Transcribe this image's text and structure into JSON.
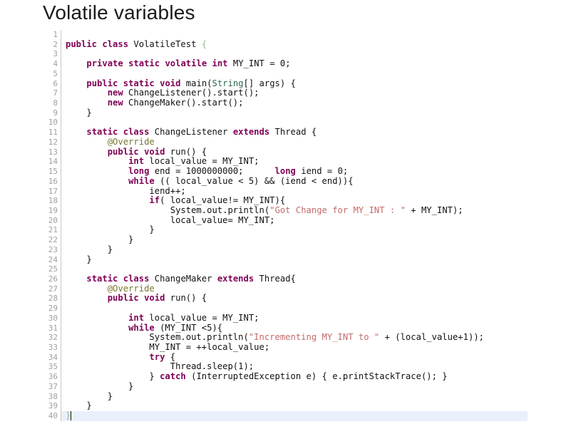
{
  "slide": {
    "title": "Volatile variables"
  },
  "editor": {
    "language": "java",
    "first_line_number": 1,
    "last_line_number": 40,
    "active_line": 40,
    "colors": {
      "background": "#ffffff",
      "gutter_text": "#a0a0a0",
      "gutter_border": "#c8c8c8",
      "active_line_highlight": "#e8f0fb",
      "keyword": "#7f0055",
      "string": "#c46a6a",
      "annotation": "#777733",
      "type": "#2b6b4f",
      "brace_faint": "#8fbf8f",
      "plain_text": "#111111"
    },
    "line_numbers": [
      "1",
      "2",
      "3",
      "4",
      "5",
      "6",
      "7",
      "8",
      "9",
      "10",
      "11",
      "12",
      "13",
      "14",
      "15",
      "16",
      "17",
      "18",
      "19",
      "20",
      "21",
      "22",
      "23",
      "24",
      "25",
      "26",
      "27",
      "28",
      "29",
      "30",
      "31",
      "32",
      "33",
      "34",
      "35",
      "36",
      "37",
      "38",
      "39",
      "40"
    ],
    "lines": [
      {
        "n": 1,
        "tokens": []
      },
      {
        "n": 2,
        "tokens": [
          {
            "t": "public",
            "c": "kw"
          },
          {
            "t": " ",
            "c": "pln"
          },
          {
            "t": "class",
            "c": "kw"
          },
          {
            "t": " VolatileTest ",
            "c": "pln"
          },
          {
            "t": "{",
            "c": "brc"
          }
        ]
      },
      {
        "n": 3,
        "tokens": []
      },
      {
        "n": 4,
        "tokens": [
          {
            "t": "    ",
            "c": "pln"
          },
          {
            "t": "private",
            "c": "kw"
          },
          {
            "t": " ",
            "c": "pln"
          },
          {
            "t": "static",
            "c": "kw"
          },
          {
            "t": " ",
            "c": "pln"
          },
          {
            "t": "volatile",
            "c": "kw"
          },
          {
            "t": " ",
            "c": "pln"
          },
          {
            "t": "int",
            "c": "kw"
          },
          {
            "t": " MY_INT = 0;",
            "c": "pln"
          }
        ]
      },
      {
        "n": 5,
        "tokens": []
      },
      {
        "n": 6,
        "tokens": [
          {
            "t": "    ",
            "c": "pln"
          },
          {
            "t": "public",
            "c": "kw"
          },
          {
            "t": " ",
            "c": "pln"
          },
          {
            "t": "static",
            "c": "kw"
          },
          {
            "t": " ",
            "c": "pln"
          },
          {
            "t": "void",
            "c": "kw"
          },
          {
            "t": " main(",
            "c": "pln"
          },
          {
            "t": "String",
            "c": "type"
          },
          {
            "t": "[] args) {",
            "c": "pln"
          }
        ]
      },
      {
        "n": 7,
        "tokens": [
          {
            "t": "        ",
            "c": "pln"
          },
          {
            "t": "new",
            "c": "kw"
          },
          {
            "t": " ChangeListener().start();",
            "c": "pln"
          }
        ]
      },
      {
        "n": 8,
        "tokens": [
          {
            "t": "        ",
            "c": "pln"
          },
          {
            "t": "new",
            "c": "kw"
          },
          {
            "t": " ChangeMaker().start();",
            "c": "pln"
          }
        ]
      },
      {
        "n": 9,
        "tokens": [
          {
            "t": "    }",
            "c": "pln"
          }
        ]
      },
      {
        "n": 10,
        "tokens": []
      },
      {
        "n": 11,
        "tokens": [
          {
            "t": "    ",
            "c": "pln"
          },
          {
            "t": "static",
            "c": "kw"
          },
          {
            "t": " ",
            "c": "pln"
          },
          {
            "t": "class",
            "c": "kw"
          },
          {
            "t": " ChangeListener ",
            "c": "pln"
          },
          {
            "t": "extends",
            "c": "kw"
          },
          {
            "t": " Thread {",
            "c": "pln"
          }
        ]
      },
      {
        "n": 12,
        "tokens": [
          {
            "t": "        ",
            "c": "pln"
          },
          {
            "t": "@Override",
            "c": "ann"
          }
        ]
      },
      {
        "n": 13,
        "tokens": [
          {
            "t": "        ",
            "c": "pln"
          },
          {
            "t": "public",
            "c": "kw"
          },
          {
            "t": " ",
            "c": "pln"
          },
          {
            "t": "void",
            "c": "kw"
          },
          {
            "t": " run() {",
            "c": "pln"
          }
        ]
      },
      {
        "n": 14,
        "tokens": [
          {
            "t": "            ",
            "c": "pln"
          },
          {
            "t": "int",
            "c": "kw"
          },
          {
            "t": " local_value = MY_INT;",
            "c": "pln"
          }
        ]
      },
      {
        "n": 15,
        "tokens": [
          {
            "t": "            ",
            "c": "pln"
          },
          {
            "t": "long",
            "c": "kw"
          },
          {
            "t": " end = 1000000000;      ",
            "c": "pln"
          },
          {
            "t": "long",
            "c": "kw"
          },
          {
            "t": " iend = 0;",
            "c": "pln"
          }
        ]
      },
      {
        "n": 16,
        "tokens": [
          {
            "t": "            ",
            "c": "pln"
          },
          {
            "t": "while",
            "c": "kw"
          },
          {
            "t": " (( local_value < 5) && (iend < end)){",
            "c": "pln"
          }
        ]
      },
      {
        "n": 17,
        "tokens": [
          {
            "t": "                iend++;",
            "c": "pln"
          }
        ]
      },
      {
        "n": 18,
        "tokens": [
          {
            "t": "                ",
            "c": "pln"
          },
          {
            "t": "if",
            "c": "kw"
          },
          {
            "t": "( local_value!= MY_INT){",
            "c": "pln"
          }
        ]
      },
      {
        "n": 19,
        "tokens": [
          {
            "t": "                    System.out.println(",
            "c": "pln"
          },
          {
            "t": "\"Got Change for MY_INT : \"",
            "c": "str"
          },
          {
            "t": " + MY_INT);",
            "c": "pln"
          }
        ]
      },
      {
        "n": 20,
        "tokens": [
          {
            "t": "                    local_value= MY_INT;",
            "c": "pln"
          }
        ]
      },
      {
        "n": 21,
        "tokens": [
          {
            "t": "                }",
            "c": "pln"
          }
        ]
      },
      {
        "n": 22,
        "tokens": [
          {
            "t": "            }",
            "c": "pln"
          }
        ]
      },
      {
        "n": 23,
        "tokens": [
          {
            "t": "        }",
            "c": "pln"
          }
        ]
      },
      {
        "n": 24,
        "tokens": [
          {
            "t": "    }",
            "c": "pln"
          }
        ]
      },
      {
        "n": 25,
        "tokens": []
      },
      {
        "n": 26,
        "tokens": [
          {
            "t": "    ",
            "c": "pln"
          },
          {
            "t": "static",
            "c": "kw"
          },
          {
            "t": " ",
            "c": "pln"
          },
          {
            "t": "class",
            "c": "kw"
          },
          {
            "t": " ChangeMaker ",
            "c": "pln"
          },
          {
            "t": "extends",
            "c": "kw"
          },
          {
            "t": " Thread{",
            "c": "pln"
          }
        ]
      },
      {
        "n": 27,
        "tokens": [
          {
            "t": "        ",
            "c": "pln"
          },
          {
            "t": "@Override",
            "c": "ann"
          }
        ]
      },
      {
        "n": 28,
        "tokens": [
          {
            "t": "        ",
            "c": "pln"
          },
          {
            "t": "public",
            "c": "kw"
          },
          {
            "t": " ",
            "c": "pln"
          },
          {
            "t": "void",
            "c": "kw"
          },
          {
            "t": " run() {",
            "c": "pln"
          }
        ]
      },
      {
        "n": 29,
        "tokens": []
      },
      {
        "n": 30,
        "tokens": [
          {
            "t": "            ",
            "c": "pln"
          },
          {
            "t": "int",
            "c": "kw"
          },
          {
            "t": " local_value = MY_INT;",
            "c": "pln"
          }
        ]
      },
      {
        "n": 31,
        "tokens": [
          {
            "t": "            ",
            "c": "pln"
          },
          {
            "t": "while",
            "c": "kw"
          },
          {
            "t": " (MY_INT <5){",
            "c": "pln"
          }
        ]
      },
      {
        "n": 32,
        "tokens": [
          {
            "t": "                System.out.println(",
            "c": "pln"
          },
          {
            "t": "\"Incrementing MY_INT to \"",
            "c": "str"
          },
          {
            "t": " + (local_value+1));",
            "c": "pln"
          }
        ]
      },
      {
        "n": 33,
        "tokens": [
          {
            "t": "                MY_INT = ++local_value;",
            "c": "pln"
          }
        ]
      },
      {
        "n": 34,
        "tokens": [
          {
            "t": "                ",
            "c": "pln"
          },
          {
            "t": "try",
            "c": "kw"
          },
          {
            "t": " {",
            "c": "pln"
          }
        ]
      },
      {
        "n": 35,
        "tokens": [
          {
            "t": "                    Thread.sleep(1);",
            "c": "pln"
          }
        ]
      },
      {
        "n": 36,
        "tokens": [
          {
            "t": "                } ",
            "c": "pln"
          },
          {
            "t": "catch",
            "c": "kw"
          },
          {
            "t": " (InterruptedException e) { e.printStackTrace(); }",
            "c": "pln"
          }
        ]
      },
      {
        "n": 37,
        "tokens": [
          {
            "t": "            }",
            "c": "pln"
          }
        ]
      },
      {
        "n": 38,
        "tokens": [
          {
            "t": "        }",
            "c": "pln"
          }
        ]
      },
      {
        "n": 39,
        "tokens": [
          {
            "t": "    }",
            "c": "pln"
          }
        ]
      },
      {
        "n": 40,
        "tokens": [
          {
            "t": "}",
            "c": "brc"
          }
        ],
        "active": true
      }
    ]
  }
}
